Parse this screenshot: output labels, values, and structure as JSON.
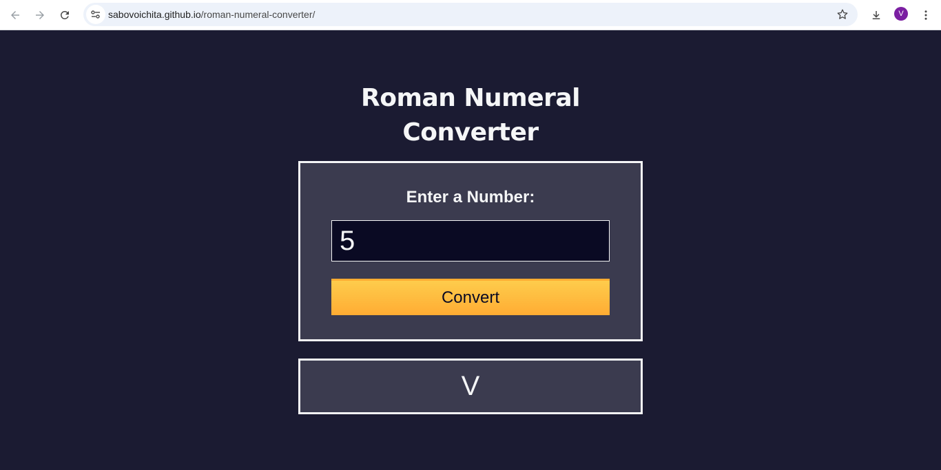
{
  "browser": {
    "url_host": "sabovoichita.github.io",
    "url_path": "/roman-numeral-converter/",
    "profile_initial": "V",
    "icons": [
      "back-arrow-icon",
      "forward-arrow-icon",
      "reload-icon",
      "site-settings-icon",
      "bookmark-star-icon",
      "download-icon",
      "kebab-menu-icon"
    ]
  },
  "page": {
    "title_line1": "Roman Numeral",
    "title_line2": "Converter",
    "label": "Enter a Number:",
    "input_value": "5",
    "convert_label": "Convert",
    "output": "V"
  },
  "colors": {
    "background": "#1b1b32",
    "panel": "#3b3b4f",
    "input_bg": "#0a0a23",
    "button_top": "#fecc4c",
    "button_bottom": "#ffac33",
    "text": "#f5f6f7"
  }
}
